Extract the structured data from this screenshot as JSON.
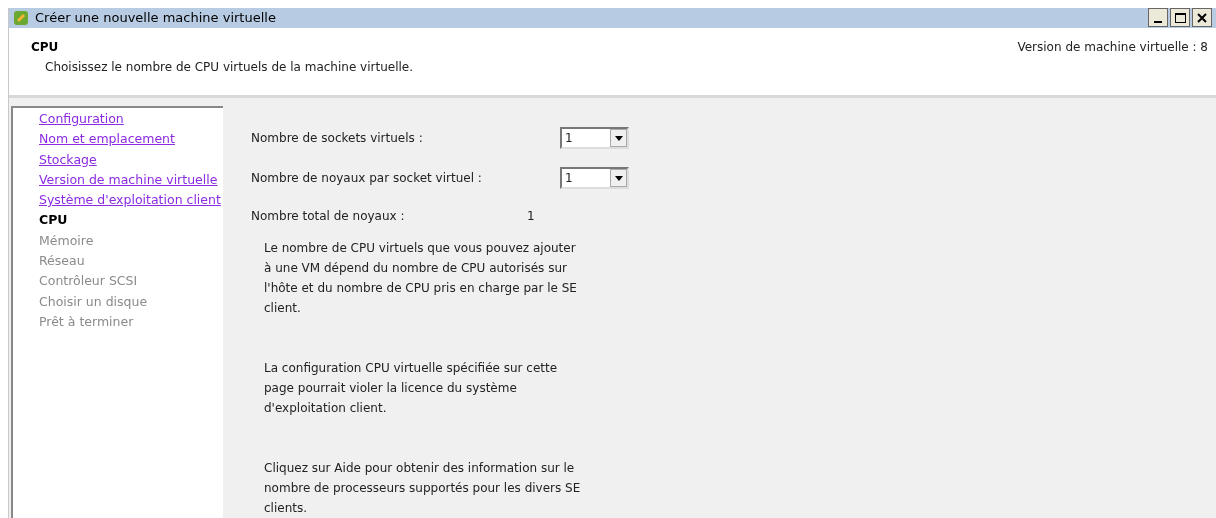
{
  "window": {
    "title": "Créer une nouvelle machine virtuelle"
  },
  "header": {
    "title": "CPU",
    "subtitle": "Choisissez le nombre de CPU virtuels de la machine virtuelle.",
    "version": "Version de machine virtuelle : 8"
  },
  "steps": [
    {
      "label": "Configuration",
      "kind": "done"
    },
    {
      "label": "Nom et emplacement",
      "kind": "done"
    },
    {
      "label": "Stockage",
      "kind": "done"
    },
    {
      "label": "Version de machine virtuelle",
      "kind": "done"
    },
    {
      "label": "Système d'exploitation client",
      "kind": "done"
    },
    {
      "label": "CPU",
      "kind": "current"
    },
    {
      "label": "Mémoire",
      "kind": "pending"
    },
    {
      "label": "Réseau",
      "kind": "pending"
    },
    {
      "label": "Contrôleur SCSI",
      "kind": "pending"
    },
    {
      "label": "Choisir un disque",
      "kind": "pending"
    },
    {
      "label": "Prêt à terminer",
      "kind": "pending"
    }
  ],
  "fields": [
    {
      "label": "Nombre de sockets virtuels :",
      "value": "1"
    },
    {
      "label": "Nombre de noyaux par socket virtuel :",
      "value": "1"
    }
  ],
  "total": {
    "label": "Nombre total de noyaux :",
    "value": "1"
  },
  "notes": [
    "Le nombre de CPU virtuels que vous pouvez ajouter à une VM dépend du nombre de CPU autorisés sur l'hôte et du nombre de CPU pris en charge par le SE client.",
    "La configuration CPU virtuelle spécifiée sur cette page pourrait violer la licence du système d'exploitation client.",
    "Cliquez sur Aide pour obtenir des information sur le nombre de processeurs supportés pour les divers SE clients."
  ]
}
